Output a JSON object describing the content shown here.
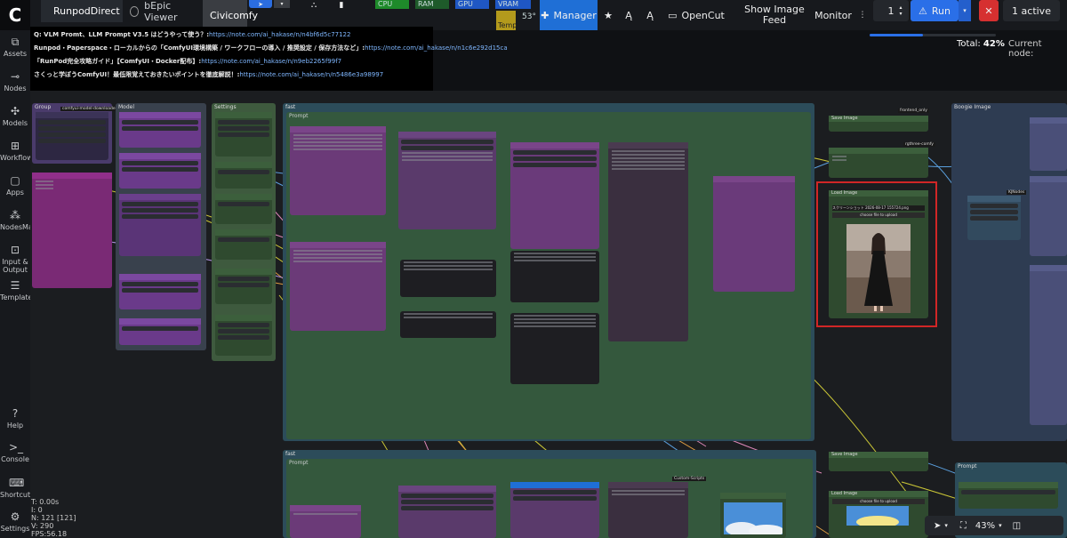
{
  "topbar": {
    "tabs": [
      {
        "label": "RunpodDirect"
      },
      {
        "label": "bEpic Viewer"
      },
      {
        "label": "Civicomfy"
      }
    ],
    "monitor": {
      "cpu": "CPU",
      "ram": "RAM",
      "gpu": "GPU",
      "vram": "VRAM",
      "temp_label": "Temp",
      "temp_value": "53°"
    },
    "manager_label": "Manager",
    "opencut_label": "OpenCut",
    "show_image_feed_label": "Show Image Feed",
    "monitor_label": "Monitor",
    "queue_count": "1",
    "run_label": "Run",
    "active_label": "1 active"
  },
  "progress": {
    "total_label": "Total:",
    "total_value": "42%",
    "current_node_label": "Current node:",
    "fraction": 0.42
  },
  "sidebar": {
    "items": [
      {
        "label": "Assets",
        "icon": "assets-icon"
      },
      {
        "label": "Nodes",
        "icon": "nodes-icon"
      },
      {
        "label": "Models",
        "icon": "models-icon"
      },
      {
        "label": "Workflows",
        "icon": "workflows-icon"
      },
      {
        "label": "Apps",
        "icon": "apps-icon"
      },
      {
        "label": "NodesMap",
        "icon": "nodesmap-icon"
      },
      {
        "label": "Input & Output",
        "icon": "input-output-icon"
      },
      {
        "label": "Templates",
        "icon": "templates-icon"
      }
    ],
    "bottom": [
      {
        "label": "Help",
        "icon": "help-icon"
      },
      {
        "label": "Console",
        "icon": "console-icon"
      },
      {
        "label": "Shortcuts",
        "icon": "keyboard-icon"
      },
      {
        "label": "Settings",
        "icon": "gear-icon"
      }
    ]
  },
  "stats": {
    "t": "T: 0.00s",
    "i": "I: 0",
    "n": "N: 121 [121]",
    "v": "V: 290",
    "fps": "FPS:56.18"
  },
  "notes": {
    "line1_text": "Q: VLM Promt、LLM Prompt V3.5 はどうやって使う？:",
    "line1_link": "https://note.com/ai_hakase/n/n4bf6d5c77122",
    "line2_text": "Runpod・Paperspace・ローカルからの「ComfyUI環境構築 / ワークフローの導入 / 推奨設定 / 保存方法など」:",
    "line2_link": "https://note.com/ai_hakase/n/n1c6e292d15ca",
    "line3_text": "「RunPod完全攻略ガイド」【ComfyUI・Docker配布】:",
    "line3_link": "https://note.com/ai_hakase/n/n9eb2265f99f7",
    "line4_text": "さくっと学ぼうComfyUI！最低限覚えておきたいポイントを徹底解説！:",
    "line4_link": "https://note.com/ai_hakase/n/n5486e3a98997"
  },
  "canvas": {
    "groups": {
      "group": "Group",
      "model": "Model",
      "settings": "Settings",
      "fast": "fast",
      "prompt": "Prompt",
      "boogie": "Boogie Image",
      "bottom_fast": "fast",
      "bottom_prompt": "Prompt"
    },
    "nodes": {
      "save_image": "Save Image",
      "load_image": "Load Image",
      "load_image_file": "スクリーンショット 2026-08-17 155724.png",
      "choose_file": "choose file to upload",
      "tags": [
        "frontend_only",
        "rgthree-comfy",
        "KJNodes",
        "comfyui-model-downloader",
        "Custom-Scripts",
        "Image"
      ]
    }
  },
  "zoom": {
    "value": "43%"
  },
  "colors": {
    "accent_blue": "#1f6fd6",
    "run_blue": "#2a6fe8",
    "stop_red": "#d63030",
    "selection_red": "#d02626"
  }
}
